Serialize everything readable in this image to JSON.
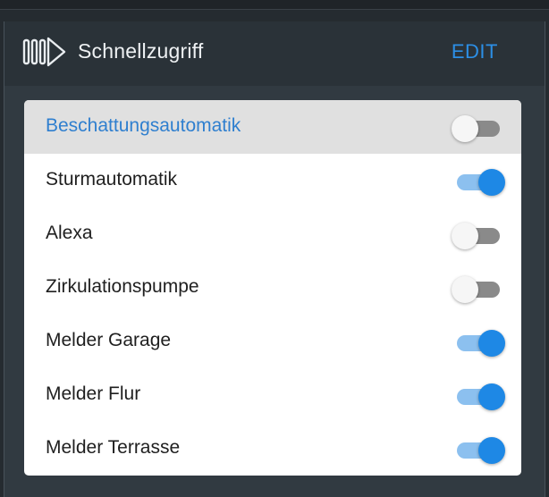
{
  "header": {
    "title": "Schnellzugriff",
    "edit_label": "EDIT",
    "icon": "shutter-arrow-icon"
  },
  "colors": {
    "accent": "#1e88e5",
    "edit": "#2c8fe6",
    "header_bg": "#2a3238",
    "panel_bg": "#313a41"
  },
  "items": [
    {
      "label": "Beschattungsautomatik",
      "on": false,
      "selected": true
    },
    {
      "label": "Sturmautomatik",
      "on": true,
      "selected": false
    },
    {
      "label": "Alexa",
      "on": false,
      "selected": false
    },
    {
      "label": "Zirkulationspumpe",
      "on": false,
      "selected": false
    },
    {
      "label": "Melder Garage",
      "on": true,
      "selected": false
    },
    {
      "label": "Melder Flur",
      "on": true,
      "selected": false
    },
    {
      "label": "Melder Terrasse",
      "on": true,
      "selected": false
    }
  ]
}
